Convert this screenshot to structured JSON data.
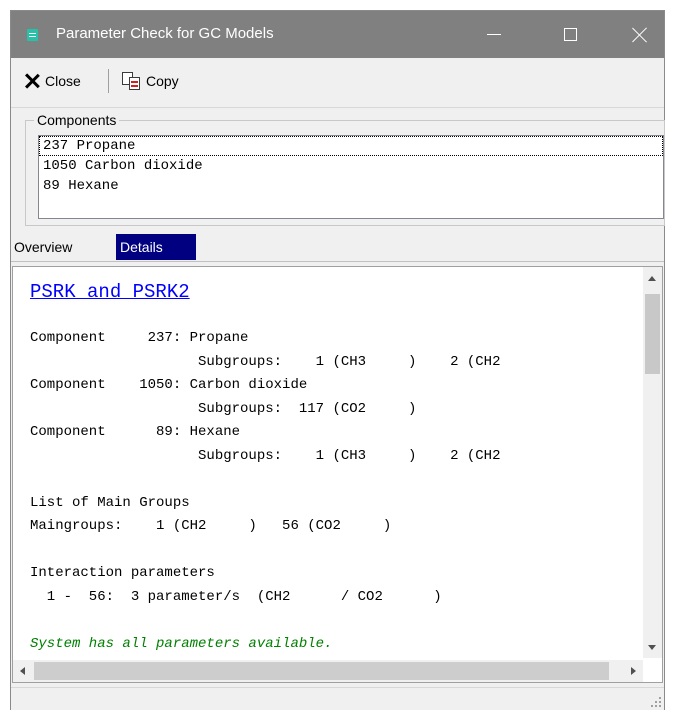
{
  "window": {
    "title": "Parameter Check for GC Models",
    "icon": "app-window-icon"
  },
  "toolbar": {
    "close_label": "Close",
    "copy_label": "Copy"
  },
  "components": {
    "legend": "Components",
    "items": [
      "237 Propane",
      "1050 Carbon dioxide",
      "89 Hexane"
    ]
  },
  "tabs": {
    "overview": "Overview",
    "details": "Details",
    "active": "Details"
  },
  "details": {
    "heading": "PSRK and PSRK2",
    "lines": [
      "Component     237: Propane",
      "                    Subgroups:    1 (CH3     )    2 (CH2",
      "Component    1050: Carbon dioxide",
      "                    Subgroups:  117 (CO2     )",
      "Component      89: Hexane",
      "                    Subgroups:    1 (CH3     )    2 (CH2",
      "",
      "List of Main Groups",
      "Maingroups:    1 (CH2     )   56 (CO2     )",
      "",
      "Interaction parameters",
      "  1 -  56:  3 parameter/s  (CH2      / CO2      )",
      ""
    ],
    "status": "System has all parameters available."
  },
  "colors": {
    "titlebar": "#808080",
    "active_tab": "#000080",
    "heading": "#0000ff",
    "status_text": "#008000"
  }
}
